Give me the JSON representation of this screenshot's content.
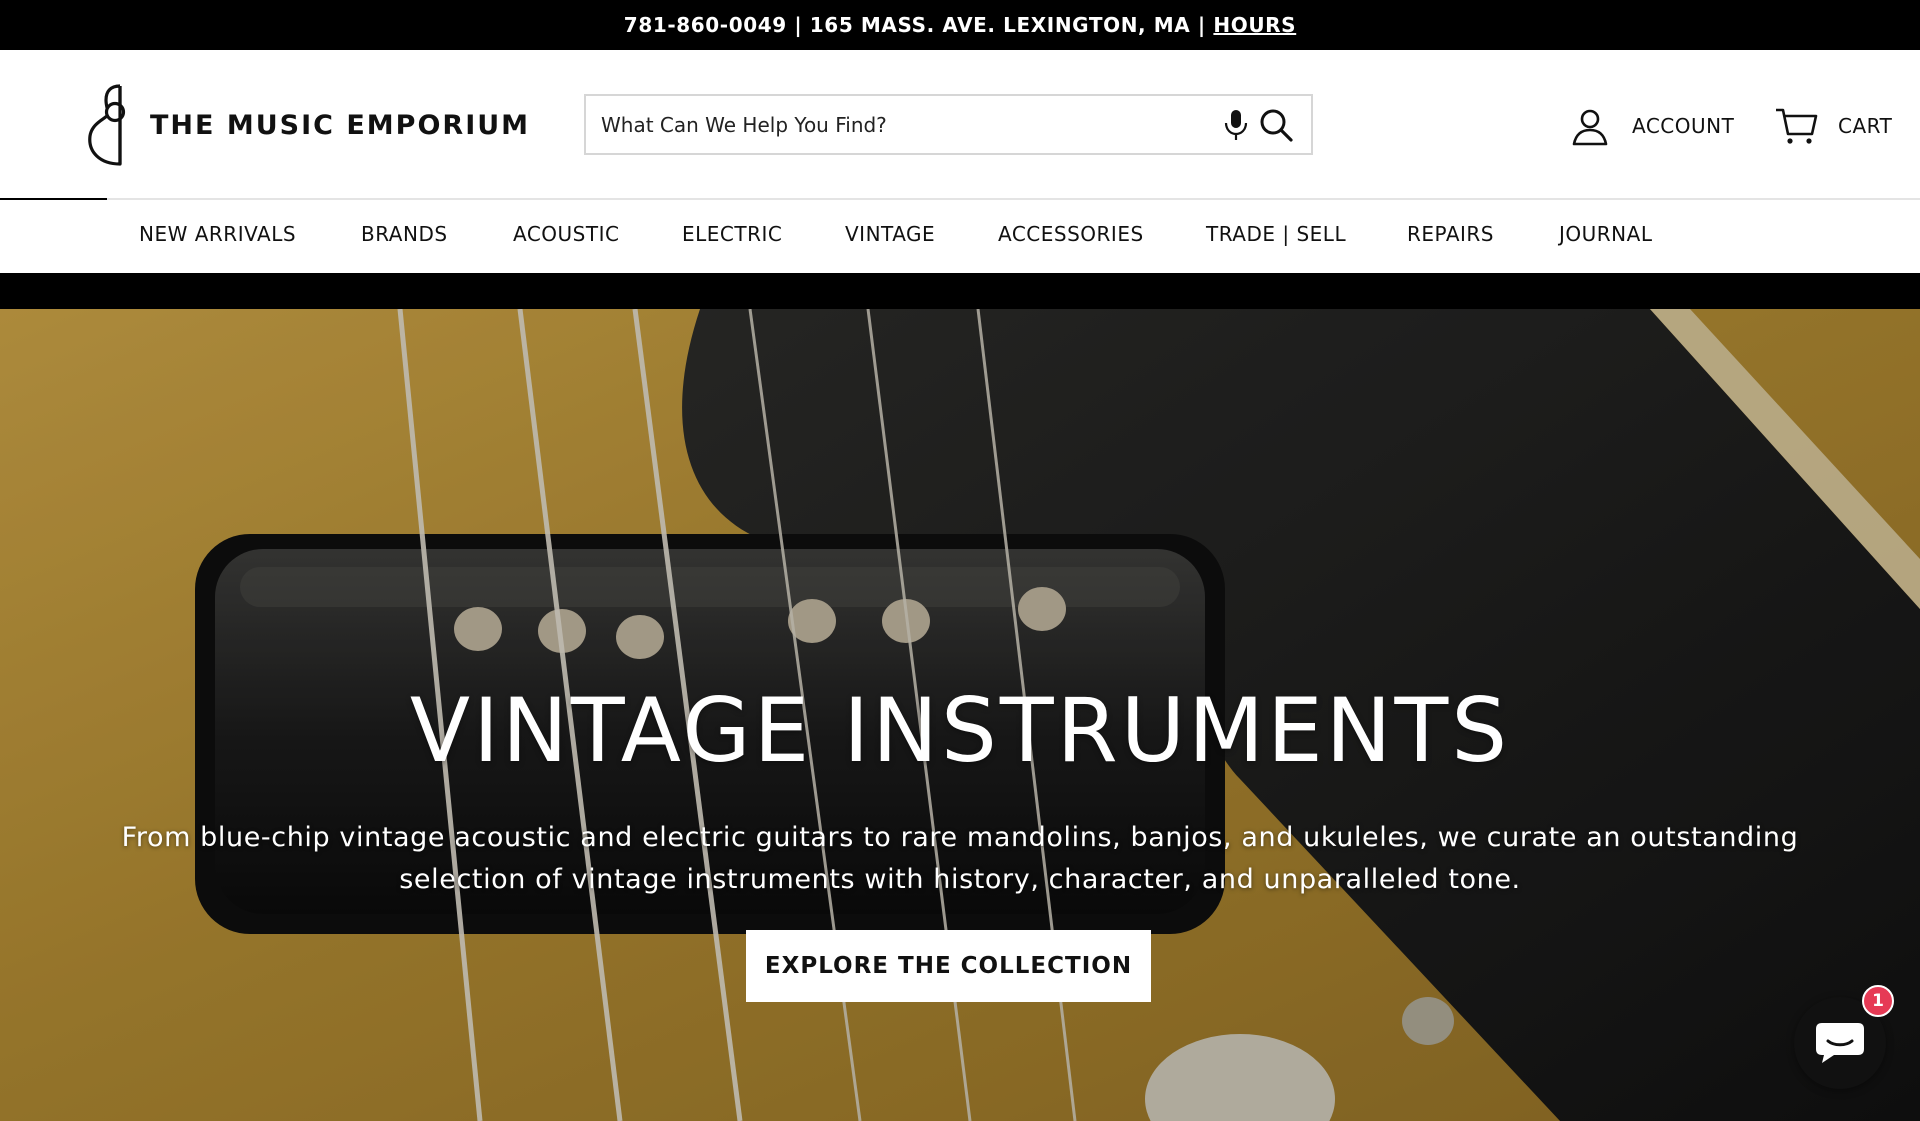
{
  "announcement": {
    "text": "781-860-0049 | 165 MASS. AVE. LEXINGTON, MA | ",
    "hours_link": "HOURS"
  },
  "header": {
    "brand": "THE MUSIC EMPORIUM",
    "search": {
      "placeholder": "What Can We Help You Find?"
    },
    "account_label": "ACCOUNT",
    "cart_label": "CART"
  },
  "nav": {
    "items": [
      {
        "label": "NEW ARRIVALS"
      },
      {
        "label": "BRANDS"
      },
      {
        "label": "ACOUSTIC"
      },
      {
        "label": "ELECTRIC"
      },
      {
        "label": "VINTAGE"
      },
      {
        "label": "ACCESSORIES"
      },
      {
        "label": "TRADE | SELL"
      },
      {
        "label": "REPAIRS"
      },
      {
        "label": "JOURNAL"
      }
    ]
  },
  "hero": {
    "title": "VINTAGE INSTRUMENTS",
    "subtitle": "From blue-chip vintage acoustic and electric guitars to rare mandolins, banjos, and ukuleles, we curate an outstanding selection of vintage instruments with history, character, and unparalleled tone.",
    "cta": "EXPLORE THE COLLECTION"
  },
  "chat": {
    "badge_count": "1"
  },
  "icons": {
    "logo": "guitar-outline-logo-icon",
    "mic": "microphone-icon",
    "search": "search-icon",
    "account": "user-icon",
    "cart": "cart-icon",
    "chat": "chat-bubble-icon"
  },
  "colors": {
    "announcement_bg": "#000000",
    "header_bg": "#ffffff",
    "hero_body": "#b7913a",
    "chat_badge": "#e63a55"
  }
}
